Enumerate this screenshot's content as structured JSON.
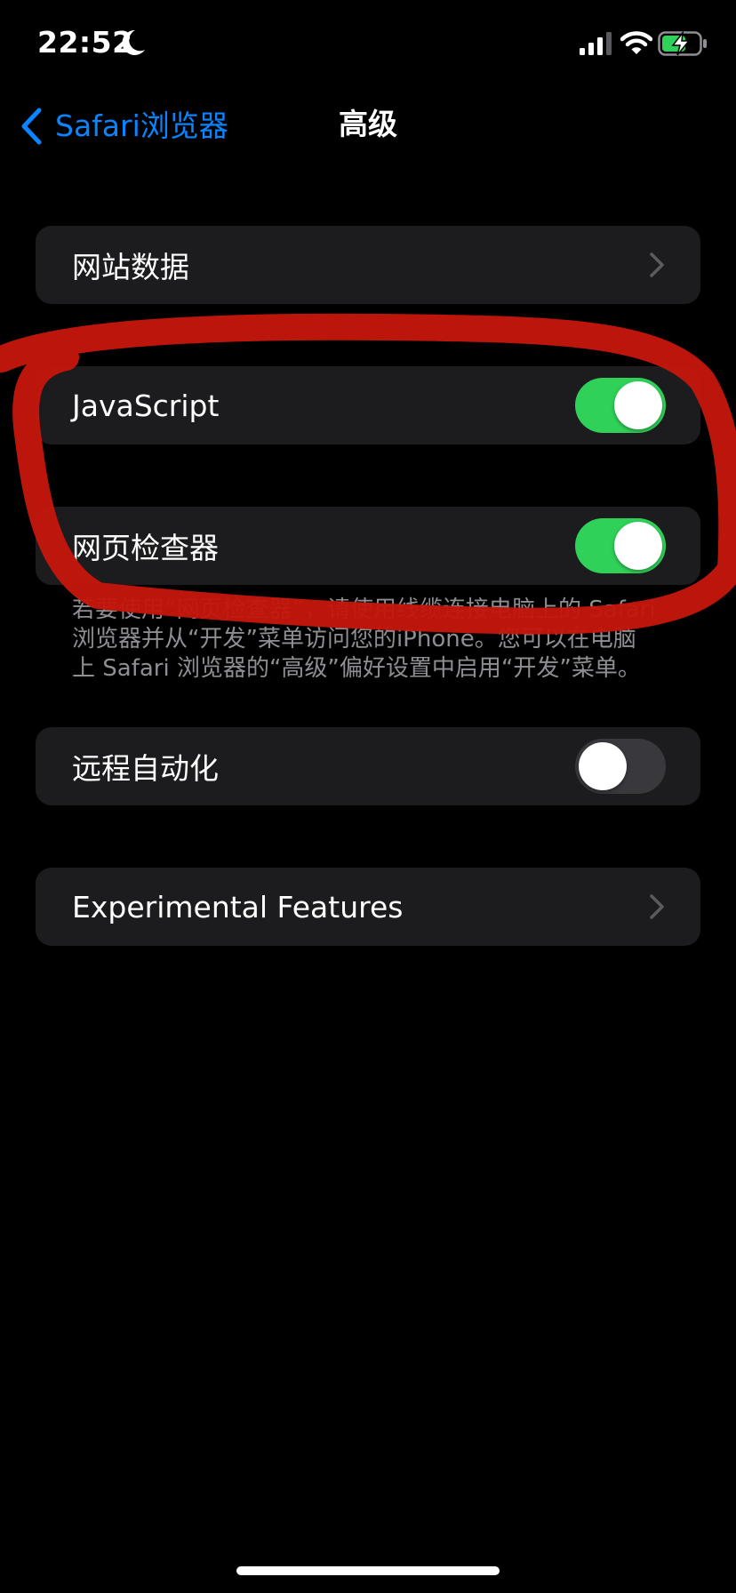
{
  "status_bar": {
    "time": "22:52",
    "icons": [
      "moon-icon",
      "cellular-signal-icon",
      "wifi-icon",
      "battery-charging-icon"
    ]
  },
  "nav": {
    "back_label": "Safari浏览器",
    "title": "高级"
  },
  "cells": {
    "website_data": {
      "label": "网站数据"
    },
    "javascript": {
      "label": "JavaScript",
      "on": true
    },
    "web_inspector": {
      "label": "网页检查器",
      "on": true
    },
    "remote_automation": {
      "label": "远程自动化",
      "on": false
    },
    "experimental": {
      "label": "Experimental Features"
    }
  },
  "web_inspector_footer": {
    "line1": "若要使用“网页检查器”，请使用线缆连接电脑上的 Safari",
    "line2": "浏览器并从“开发”菜单访问您的iPhone。您可以在电脑",
    "line3": "上 Safari 浏览器的“高级”偏好设置中启用“开发”菜单。"
  },
  "colors": {
    "background": "#000000",
    "cell": "#1c1c1e",
    "accent": "#0a84ff",
    "toggle_on": "#30d158",
    "annotation": "#c4160c"
  }
}
